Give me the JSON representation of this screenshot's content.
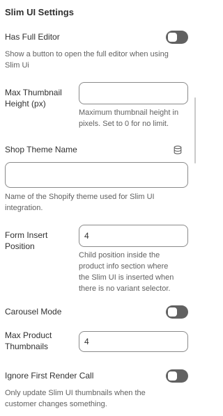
{
  "title": "Slim UI Settings",
  "fields": {
    "has_full_editor": {
      "label": "Has Full Editor",
      "help": [
        "Show a button to open the full editor when using",
        "Slim Ui"
      ]
    },
    "max_thumbnail_height": {
      "label": [
        "Max Thumbnail",
        "Height (px)"
      ],
      "value": "",
      "help": [
        "Maximum thumbnail height in",
        "pixels. Set to 0 for no limit."
      ]
    },
    "shop_theme_name": {
      "label": "Shop Theme Name",
      "value": "",
      "help": [
        "Name of the Shopify theme used for Slim UI",
        "integration."
      ],
      "icon": "database-icon"
    },
    "form_insert_position": {
      "label": [
        "Form Insert",
        "Position"
      ],
      "value": "4",
      "help": [
        "Child position inside the",
        "product info section where",
        "the Slim UI is inserted when",
        "there is no variant selector."
      ]
    },
    "carousel_mode": {
      "label": "Carousel Mode"
    },
    "max_product_thumbnails": {
      "label": [
        "Max Product",
        "Thumbnails"
      ],
      "value": "4"
    },
    "ignore_first_render_call": {
      "label": "Ignore First Render Call",
      "help": [
        "Only update Slim UI thumbnails when the",
        "customer changes something."
      ]
    }
  },
  "colors": {
    "toggle_off": "#616161",
    "text": "#303030",
    "help_text": "#616161",
    "border": "#8a8a8a"
  }
}
